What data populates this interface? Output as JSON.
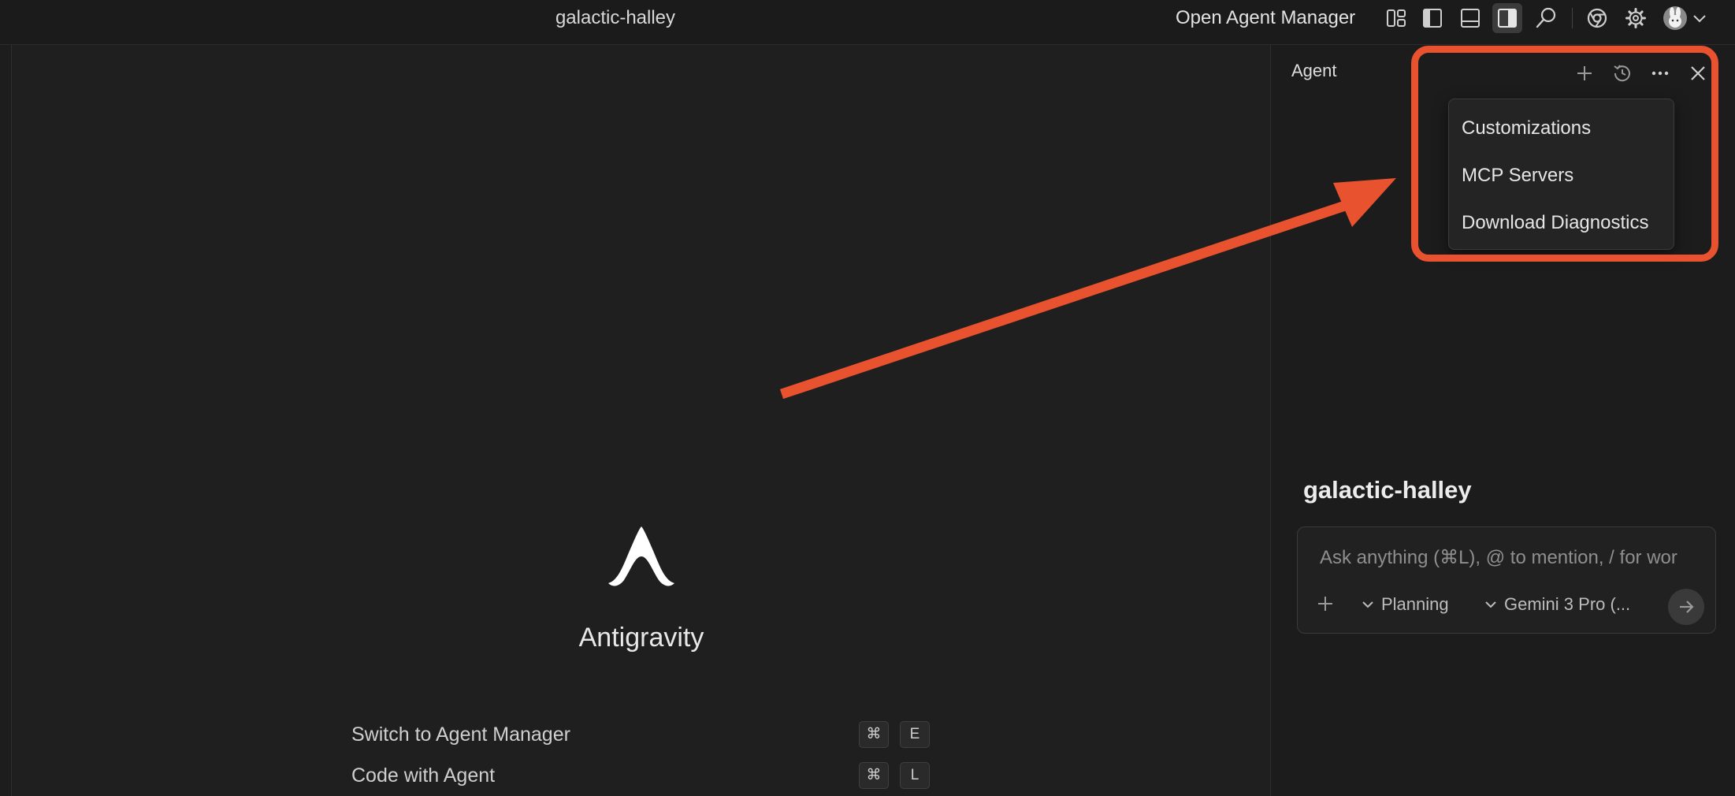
{
  "titlebar": {
    "window_title": "galactic-halley",
    "open_agent_manager": "Open Agent Manager",
    "icons": [
      "layout-icon",
      "toggle-primary-sidebar-icon",
      "toggle-panel-icon",
      "toggle-secondary-sidebar-icon",
      "search-icon",
      "chrome-icon",
      "gear-icon",
      "avatar",
      "chevron-down-icon"
    ]
  },
  "welcome": {
    "app_name": "Antigravity",
    "shortcuts": [
      {
        "label": "Switch to Agent Manager",
        "keys": [
          "⌘",
          "E"
        ]
      },
      {
        "label": "Code with Agent",
        "keys": [
          "⌘",
          "L"
        ]
      }
    ]
  },
  "agent_panel": {
    "header": "Agent",
    "icons": [
      "plus-icon",
      "history-icon",
      "more-icon",
      "close-icon"
    ],
    "menu": {
      "items": [
        "Customizations",
        "MCP Servers",
        "Download Diagnostics"
      ]
    },
    "workspace_title": "galactic-halley",
    "chat": {
      "placeholder": "Ask anything (⌘L), @ to mention, / for wor",
      "mode": "Planning",
      "model": "Gemini 3 Pro (..."
    }
  },
  "annotation": {
    "color": "#e9522f"
  },
  "theme": {
    "background": "#1f1f1f",
    "panel": "#1c1c1c",
    "text": "#e6e6e6"
  }
}
